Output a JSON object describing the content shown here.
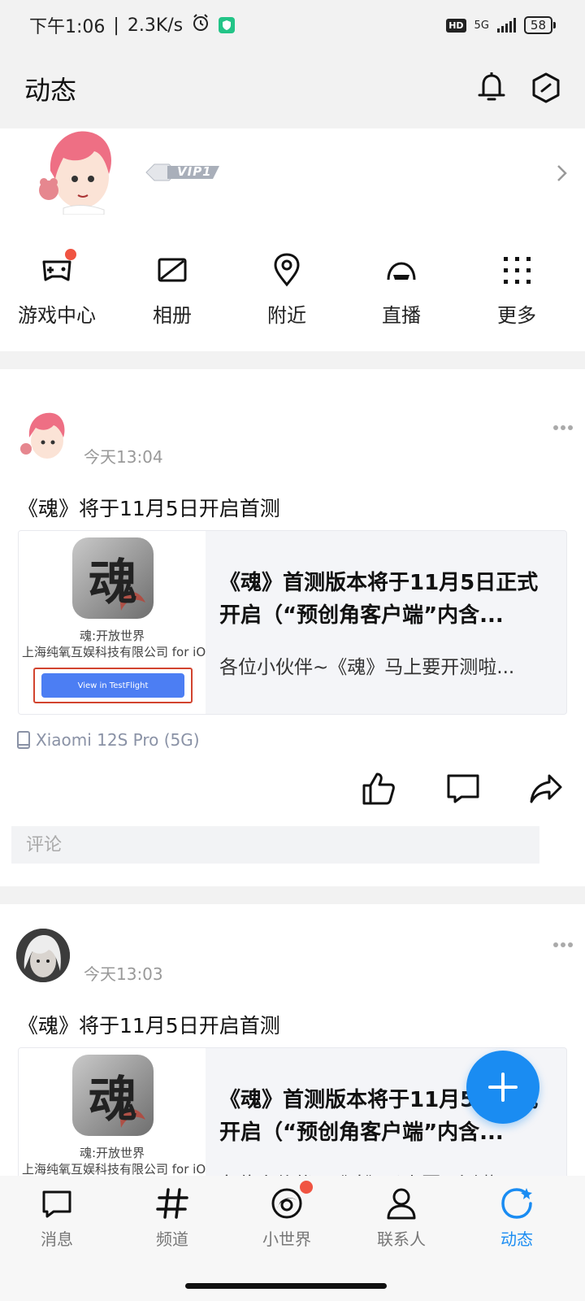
{
  "status_bar": {
    "time": "下午1:06",
    "speed": "2.3K/s",
    "hd": "HD",
    "network": "5G",
    "battery": "58"
  },
  "header": {
    "title": "动态"
  },
  "profile": {
    "vip_label": "VIP1"
  },
  "quick_actions": [
    {
      "label": "游戏中心",
      "icon": "gamepad-icon",
      "has_dot": true
    },
    {
      "label": "相册",
      "icon": "album-icon",
      "has_dot": false
    },
    {
      "label": "附近",
      "icon": "location-pin-icon",
      "has_dot": false
    },
    {
      "label": "直播",
      "icon": "live-icon",
      "has_dot": false
    },
    {
      "label": "更多",
      "icon": "grid-dots-icon",
      "has_dot": false
    }
  ],
  "posts": [
    {
      "time": "今天13:04",
      "text": "《魂》将于11月5日开启首测",
      "card": {
        "thumb_char": "魂",
        "thumb_name": "魂:开放世界",
        "thumb_company": "上海纯氧互娱科技有限公司 for iOS",
        "thumb_button": "View in TestFlight",
        "title": "《魂》首测版本将于11月5日正式开启（“预创角客户端”内含...",
        "desc": "各位小伙伴~《魂》马上要开测啦..."
      },
      "device": "Xiaomi 12S Pro (5G)",
      "comment_placeholder": "评论"
    },
    {
      "time": "今天13:03",
      "text": "《魂》将于11月5日开启首测",
      "card": {
        "thumb_char": "魂",
        "thumb_name": "魂:开放世界",
        "thumb_company": "上海纯氧互娱科技有限公司 for iOS",
        "title": "《魂》首测版本将于11月5日正式开启（“预创角客户端”内含...",
        "desc": "各位小伙伴~《魂》马上要开测啦..."
      }
    }
  ],
  "tabs": [
    {
      "label": "消息",
      "icon": "message-icon",
      "active": false
    },
    {
      "label": "频道",
      "icon": "hashtag-icon",
      "active": false
    },
    {
      "label": "小世界",
      "icon": "small-world-icon",
      "active": false,
      "has_dot": true
    },
    {
      "label": "联系人",
      "icon": "contacts-icon",
      "active": false
    },
    {
      "label": "动态",
      "icon": "refresh-star-icon",
      "active": true
    }
  ],
  "colors": {
    "accent": "#1a8cf2",
    "dot": "#f05442",
    "background_gray": "#f2f2f2"
  }
}
